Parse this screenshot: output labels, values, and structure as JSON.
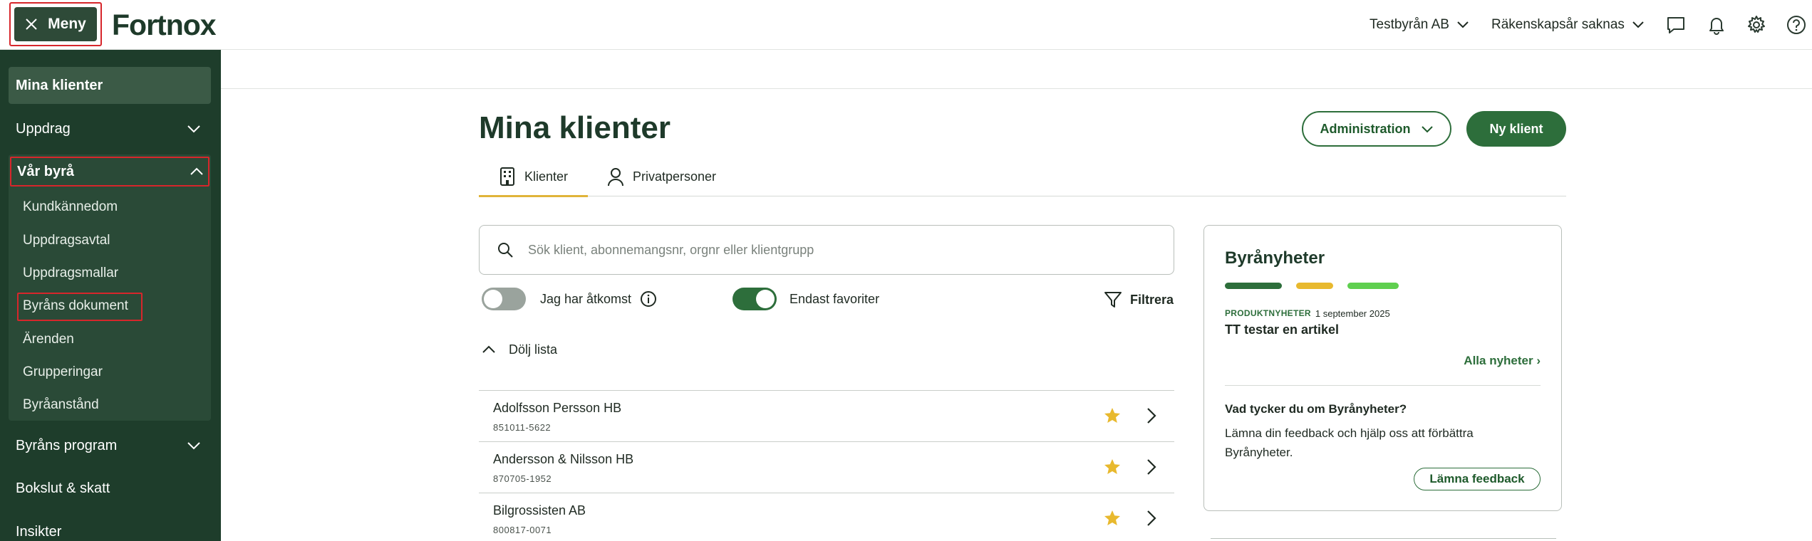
{
  "header": {
    "menu_label": "Meny",
    "logo_text": "Fortnox",
    "company_select": "Testbyrån AB",
    "year_select": "Räkenskapsår saknas",
    "icons": [
      "chat-icon",
      "bell-icon",
      "gear-icon",
      "help-icon"
    ]
  },
  "sidebar": {
    "active": "Mina klienter",
    "items": [
      {
        "label": "Uppdrag"
      },
      {
        "label": "Byråns program"
      },
      {
        "label": "Bokslut & skatt"
      },
      {
        "label": "Insikter"
      }
    ],
    "group": {
      "label": "Vår byrå",
      "subitems": [
        {
          "label": "Kundkännedom"
        },
        {
          "label": "Uppdragsavtal"
        },
        {
          "label": "Uppdragsmallar"
        },
        {
          "label": "Byråns dokument"
        },
        {
          "label": "Ärenden"
        },
        {
          "label": "Grupperingar"
        },
        {
          "label": "Byråanstånd"
        }
      ]
    }
  },
  "main": {
    "title": "Mina klienter",
    "admin_button": "Administration",
    "new_client_button": "Ny klient",
    "tabs": [
      {
        "label": "Klienter",
        "active": true
      },
      {
        "label": "Privatpersoner",
        "active": false
      }
    ],
    "search": {
      "placeholder": "Sök klient, abonnemangsnr, orgnr eller klientgrupp",
      "value": ""
    },
    "toggle_access": {
      "label": "Jag har åtkomst",
      "on": false
    },
    "toggle_favorites": {
      "label": "Endast favoriter",
      "on": true
    },
    "filter_label": "Filtrera",
    "hide_list_label": "Dölj lista",
    "clients": [
      {
        "name": "Adolfsson Persson HB",
        "nr": "851011-5622",
        "favorite": true
      },
      {
        "name": "Andersson & Nilsson HB",
        "nr": "870705-1952",
        "favorite": true
      },
      {
        "name": "Bilgrossisten AB",
        "nr": "800817-0071",
        "favorite": true
      }
    ]
  },
  "news": {
    "title": "Byrånyheter",
    "dot_colors": [
      "#2d6e3b",
      "#e8b92e",
      "#5fcf4f"
    ],
    "category": "PRODUKTNYHETER",
    "date": "1 september 2025",
    "headline": "TT testar en artikel",
    "all_news_link": "Alla nyheter ›",
    "feedback_title": "Vad tycker du om Byrånyheter?",
    "feedback_text": "Lämna din feedback och hjälp oss att förbättra Byrånyheter.",
    "feedback_button": "Lämna feedback"
  },
  "colors": {
    "sidebar_bg": "#1e3d2b",
    "brand_green": "#2d6e3b",
    "tab_accent": "#e0b43a",
    "star": "#e8b92e",
    "highlight_frame": "#d7262b"
  }
}
